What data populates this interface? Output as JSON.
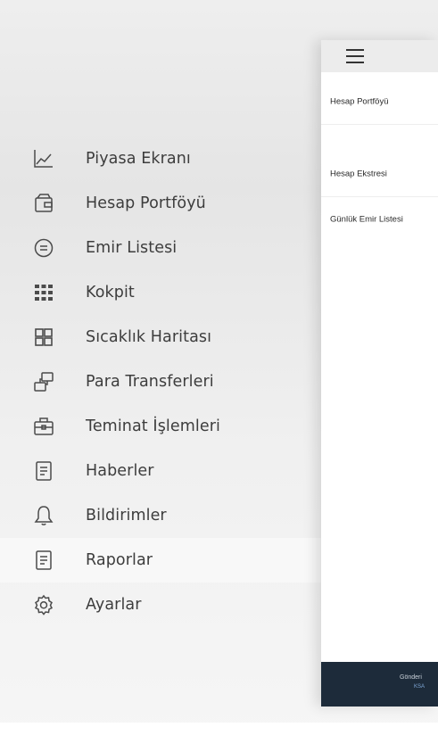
{
  "menu": {
    "items": [
      {
        "label": "Piyasa Ekranı",
        "icon": "chart-line-icon"
      },
      {
        "label": "Hesap Portföyü",
        "icon": "wallet-icon"
      },
      {
        "label": "Emir Listesi",
        "icon": "list-circle-icon"
      },
      {
        "label": "Kokpit",
        "icon": "dots-grid-icon"
      },
      {
        "label": "Sıcaklık Haritası",
        "icon": "grid-four-icon"
      },
      {
        "label": "Para Transferleri",
        "icon": "transfer-icon"
      },
      {
        "label": "Teminat İşlemleri",
        "icon": "briefcase-icon"
      },
      {
        "label": "Haberler",
        "icon": "document-icon"
      },
      {
        "label": "Bildirimler",
        "icon": "bell-icon"
      },
      {
        "label": "Raporlar",
        "icon": "report-icon",
        "active": true
      },
      {
        "label": "Ayarlar",
        "icon": "gear-icon"
      }
    ]
  },
  "panel": {
    "items": [
      {
        "label": "Hesap Portföyü"
      },
      {
        "label": "Hesap Ekstresi"
      },
      {
        "label": "Günlük Emir Listesi"
      }
    ],
    "footer": {
      "line1": "Gönderi",
      "line2": "KSA"
    }
  },
  "colors": {
    "icon": "#4b4b4b",
    "text": "#3d3d3d",
    "footer_bg": "#1d2b3a",
    "active_bg": "#f8f8f8"
  }
}
